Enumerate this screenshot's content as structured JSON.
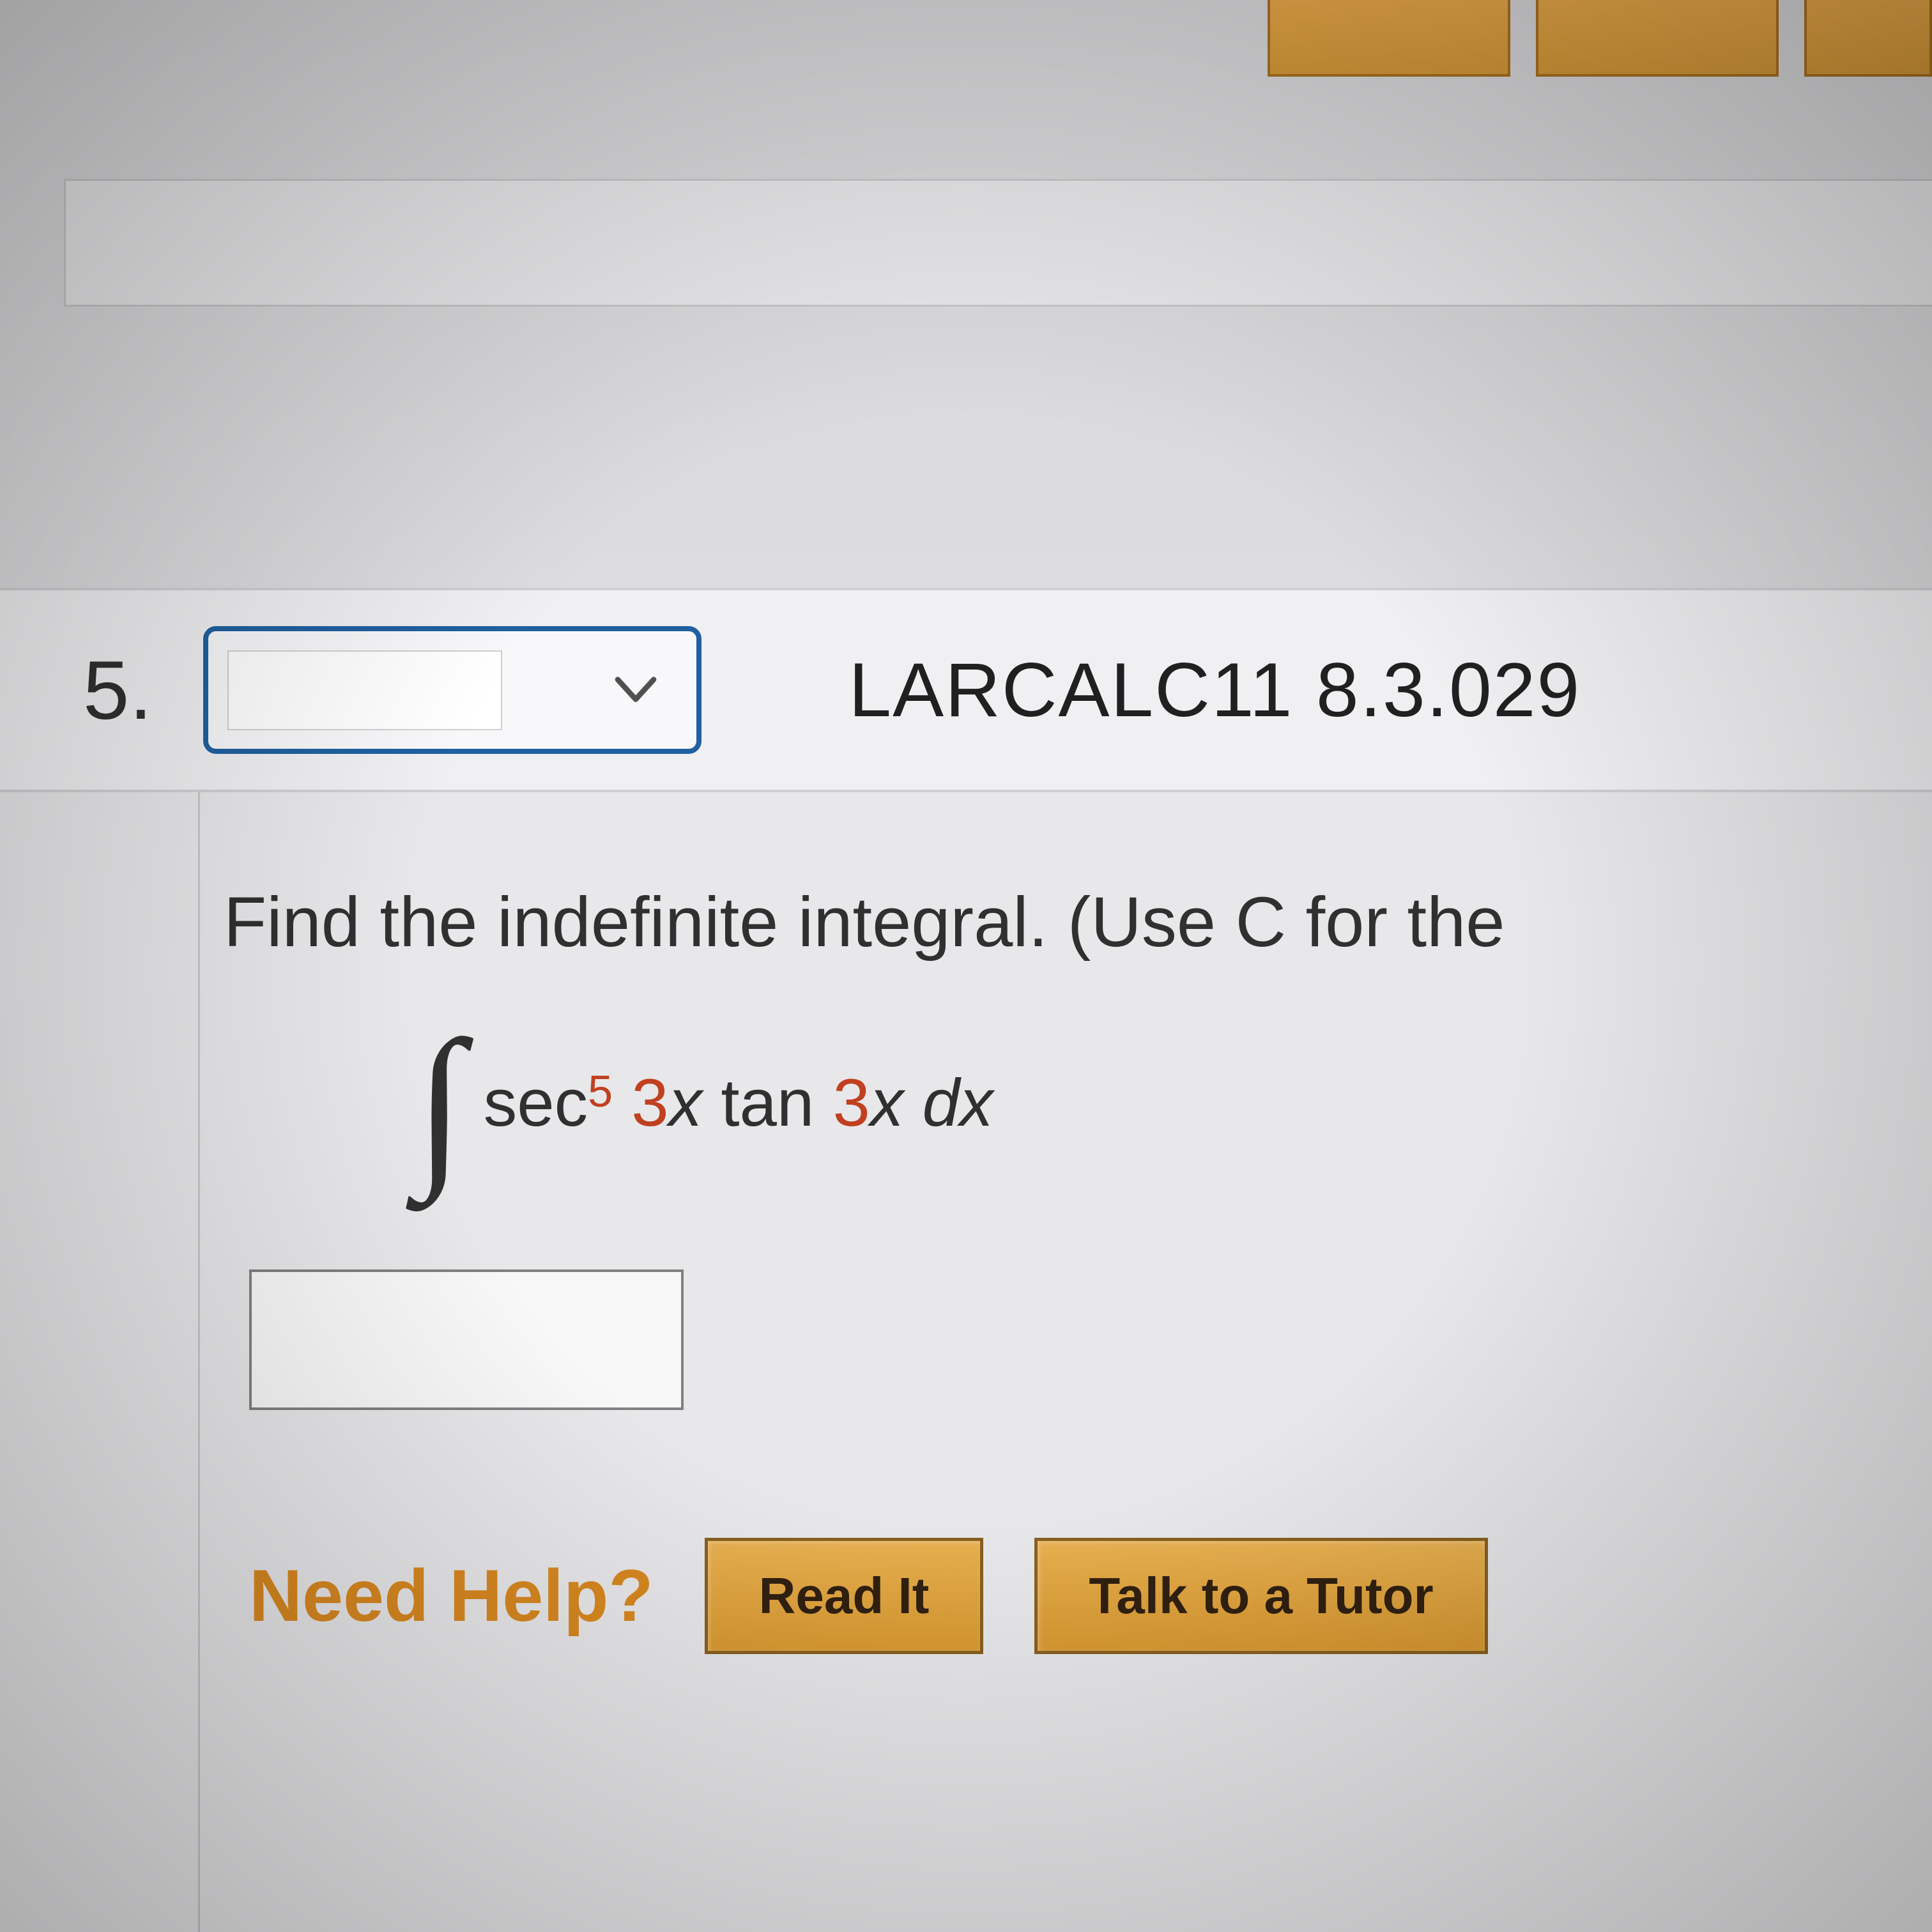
{
  "question": {
    "number": "5.",
    "reference": "LARCALC11 8.3.029",
    "instruction": "Find the indefinite integral. (Use C for the ",
    "expression": {
      "func1": "sec",
      "exp": "5",
      "coef1": "3",
      "var1": "x",
      "func2": "tan",
      "coef2": "3",
      "var2": "x",
      "diff": "dx"
    }
  },
  "help": {
    "label": "Need Help?",
    "read_button": "Read It",
    "tutor_button": "Talk to a Tutor"
  }
}
